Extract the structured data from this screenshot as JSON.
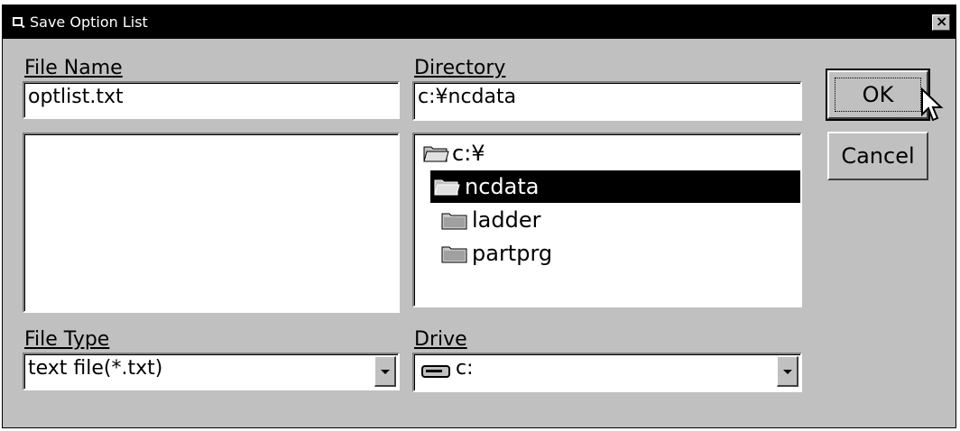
{
  "window": {
    "title": "Save Option List",
    "close_glyph": "×"
  },
  "labels": {
    "file_name": "File Name",
    "directory": "Directory",
    "file_type": "File Type",
    "drive": "Drive"
  },
  "fields": {
    "file_name_value": "optlist.txt",
    "directory_value": "c:¥ncdata"
  },
  "directory_tree": [
    {
      "label": "c:¥",
      "icon": "open-folder-icon",
      "selected": false
    },
    {
      "label": "ncdata",
      "icon": "open-folder-icon",
      "selected": true
    },
    {
      "label": "ladder",
      "icon": "folder-icon",
      "selected": false
    },
    {
      "label": "partprg",
      "icon": "folder-icon",
      "selected": false
    }
  ],
  "file_type": {
    "selected": "text file(*.txt)"
  },
  "drive": {
    "selected": "c:",
    "icon": "drive-icon"
  },
  "buttons": {
    "ok": "OK",
    "cancel": "Cancel"
  }
}
